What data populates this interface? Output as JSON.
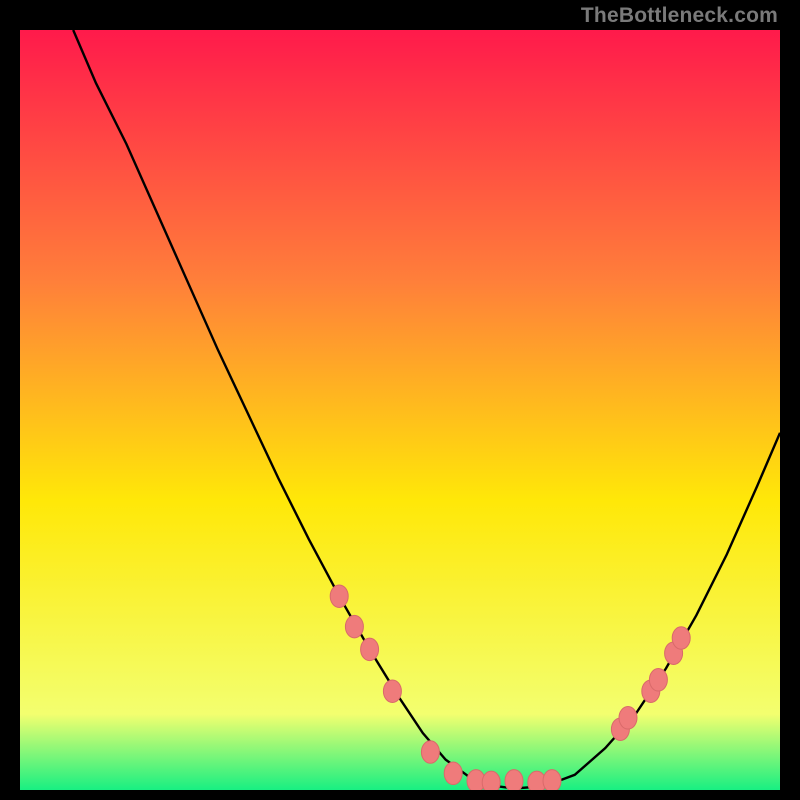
{
  "watermark": {
    "text": "TheBottleneck.com",
    "color": "#7a7a7a"
  },
  "chart_data": {
    "type": "line",
    "title": "",
    "xlabel": "",
    "ylabel": "",
    "xlim": [
      0,
      100
    ],
    "ylim": [
      0,
      100
    ],
    "grid": false,
    "legend": false,
    "background_gradient": {
      "top_color": "#ff1a4b",
      "mid_color_1": "#ff7f3a",
      "mid_color_2": "#ffe808",
      "low_color": "#f3ff6f",
      "bottom_color": "#18ef82"
    },
    "series": [
      {
        "name": "bottleneck-curve",
        "color": "#000000",
        "x": [
          7,
          10,
          14,
          18,
          22,
          26,
          30,
          34,
          38,
          42,
          46,
          50,
          53,
          56,
          59,
          62,
          65,
          69,
          73,
          77,
          81,
          85,
          89,
          93,
          97,
          100
        ],
        "y": [
          100,
          93,
          85,
          76,
          67,
          58,
          49.5,
          41,
          33,
          25.5,
          18.5,
          12,
          7.5,
          4,
          1.8,
          0.6,
          0.2,
          0.5,
          2,
          5.5,
          10,
          16,
          23,
          31,
          40,
          47
        ]
      }
    ],
    "markers": {
      "name": "highlight-dots",
      "color": "#ef7b7b",
      "stroke": "#d96a6a",
      "radius": 9,
      "points": [
        {
          "x": 42,
          "y": 25.5
        },
        {
          "x": 44,
          "y": 21.5
        },
        {
          "x": 46,
          "y": 18.5
        },
        {
          "x": 49,
          "y": 13
        },
        {
          "x": 54,
          "y": 5
        },
        {
          "x": 57,
          "y": 2.2
        },
        {
          "x": 60,
          "y": 1.2
        },
        {
          "x": 62,
          "y": 1.0
        },
        {
          "x": 65,
          "y": 1.2
        },
        {
          "x": 68,
          "y": 1.0
        },
        {
          "x": 70,
          "y": 1.2
        },
        {
          "x": 79,
          "y": 8
        },
        {
          "x": 80,
          "y": 9.5
        },
        {
          "x": 83,
          "y": 13
        },
        {
          "x": 84,
          "y": 14.5
        },
        {
          "x": 86,
          "y": 18
        },
        {
          "x": 87,
          "y": 20
        }
      ]
    }
  }
}
